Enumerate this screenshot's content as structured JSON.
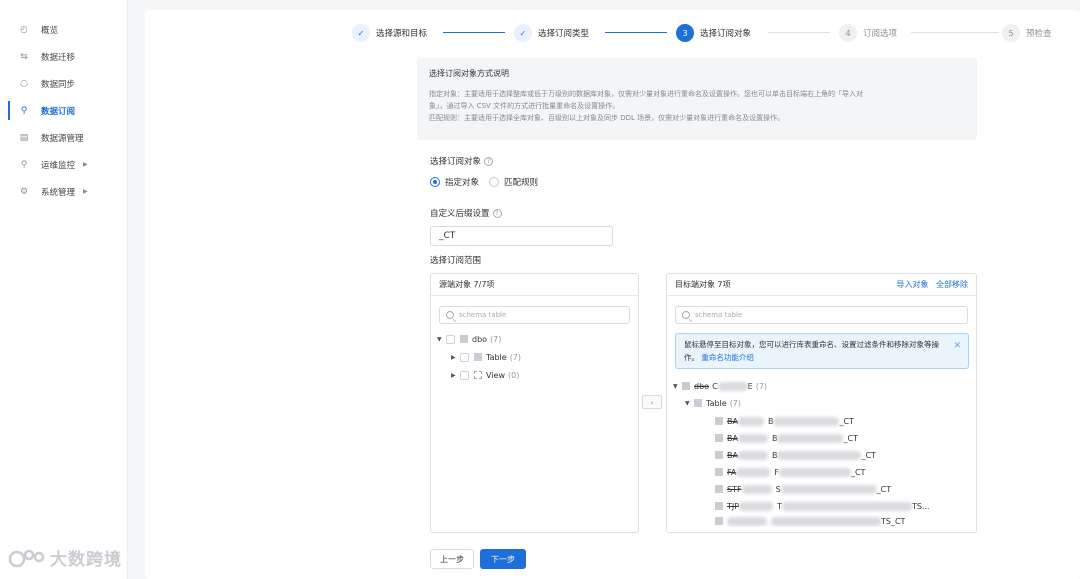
{
  "sidebar": {
    "items": [
      {
        "label": "概览",
        "icon": "dashboard-icon"
      },
      {
        "label": "数据迁移",
        "icon": "migrate-icon"
      },
      {
        "label": "数据同步",
        "icon": "sync-icon"
      },
      {
        "label": "数据订阅",
        "icon": "subscribe-icon"
      },
      {
        "label": "数据源管理",
        "icon": "datasource-icon"
      },
      {
        "label": "运维监控",
        "icon": "monitor-icon"
      },
      {
        "label": "系统管理",
        "icon": "gear-icon"
      }
    ]
  },
  "watermark": "大数跨境",
  "steps": [
    {
      "num": "✓",
      "label": "选择源和目标",
      "state": "done"
    },
    {
      "num": "✓",
      "label": "选择订阅类型",
      "state": "done"
    },
    {
      "num": "3",
      "label": "选择订阅对象",
      "state": "current"
    },
    {
      "num": "4",
      "label": "订阅选项",
      "state": "todo"
    },
    {
      "num": "5",
      "label": "预检查",
      "state": "todo"
    }
  ],
  "info": {
    "title": "选择订阅对象方式说明",
    "line1": "指定对象：主要适用于选择整库或低于万级别的数据库对象，仅需对少量对象进行重命名及设置操作。您也可以单击目标端右上角的「导入对",
    "line2": "象」，通过导入 CSV 文件的方式进行批量重命名及设置操作。",
    "line3": "匹配规则：主要适用于选择全库对象、百级别以上对象及同步 DDL 场景，仅需对少量对象进行重命名及设置操作。"
  },
  "form": {
    "object_label": "选择订阅对象",
    "radio_specified": "指定对象",
    "radio_match": "匹配规则",
    "suffix_label": "自定义后缀设置",
    "suffix_value": "_CT",
    "scope_label": "选择订阅范围"
  },
  "source": {
    "header": "源端对象 7/7项",
    "search_placeholder": "schema table",
    "tree": {
      "db": "dbo",
      "db_count": "(7)",
      "table": "Table",
      "table_count": "(7)",
      "view": "View",
      "view_count": "(0)"
    }
  },
  "target": {
    "header": "目标端对象 7项",
    "import_label": "导入对象",
    "remove_label": "全部移除",
    "search_placeholder": "schema table",
    "notice": "鼠标悬停至目标对象，您可以进行库表重命名、设置过滤条件和移除对象等操作。",
    "notice_link": "重命名功能介绍",
    "tree": {
      "db": "dbo",
      "db_prefix": "C",
      "db_suffix": "E",
      "db_count": "(7)",
      "table": "Table",
      "table_count": "(7)",
      "rows": [
        {
          "a": "BA",
          "b": "B",
          "suffix": "_CT"
        },
        {
          "a": "BA",
          "b": "B",
          "suffix": "_CT"
        },
        {
          "a": "BA",
          "b": "B",
          "suffix": "_CT"
        },
        {
          "a": "FA",
          "b": "F",
          "suffix": "_CT"
        },
        {
          "a": "STF",
          "b": "S",
          "suffix": "_CT"
        },
        {
          "a": "TJP",
          "b": "T",
          "suffix": "TS..."
        },
        {
          "a": "",
          "b": "",
          "suffix": "TS_CT"
        }
      ]
    }
  },
  "buttons": {
    "prev": "上一步",
    "next": "下一步"
  },
  "colors": {
    "primary": "#1f6fd9",
    "notice_bg": "#e9f4fd"
  }
}
